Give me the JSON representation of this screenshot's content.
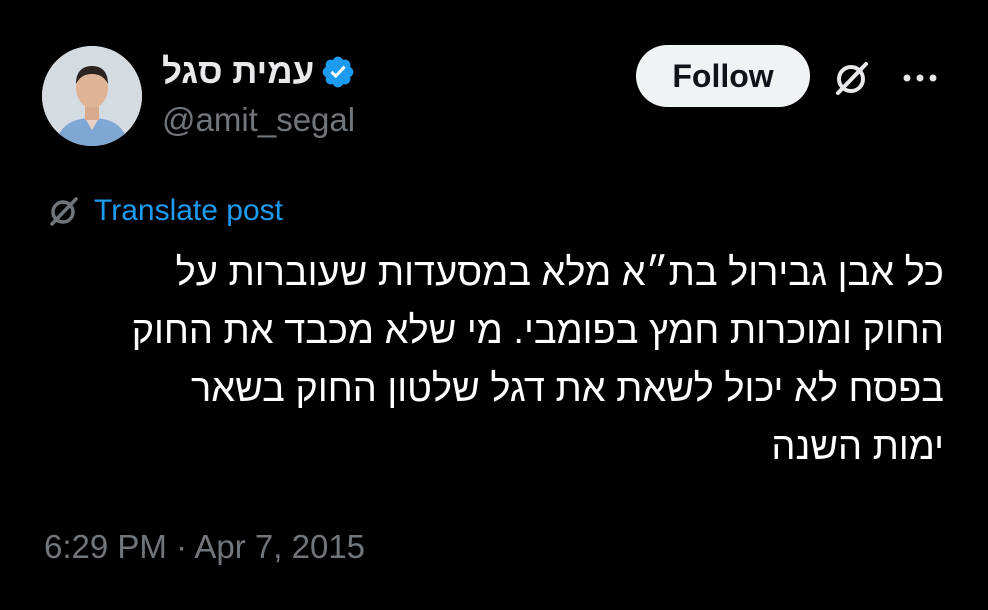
{
  "author": {
    "display_name": "עמית סגל",
    "handle": "@amit_segal",
    "verified": true,
    "avatar": "avatar-photo"
  },
  "actions": {
    "follow_label": "Follow",
    "grok_icon": "grok-icon",
    "more_icon": "more-icon"
  },
  "translate": {
    "label": "Translate post",
    "icon": "translate-icon"
  },
  "post": {
    "lines": [
      "כל אבן גבירול בת״א מלא במסעדות שעוברות על",
      "החוק ומוכרות חמץ בפומבי. מי שלא מכבד את החוק",
      "בפסח לא יכול לשאת את דגל שלטון החוק בשאר",
      "ימות השנה"
    ]
  },
  "meta": {
    "timestamp": "6:29 PM · Apr 7, 2015"
  },
  "colors": {
    "background": "#000000",
    "primary_text": "#e7e9ea",
    "secondary_text": "#71767b",
    "link": "#1d9bf0",
    "verified": "#1d9bf0",
    "follow_bg": "#eff3f4",
    "follow_text": "#0f1419"
  }
}
